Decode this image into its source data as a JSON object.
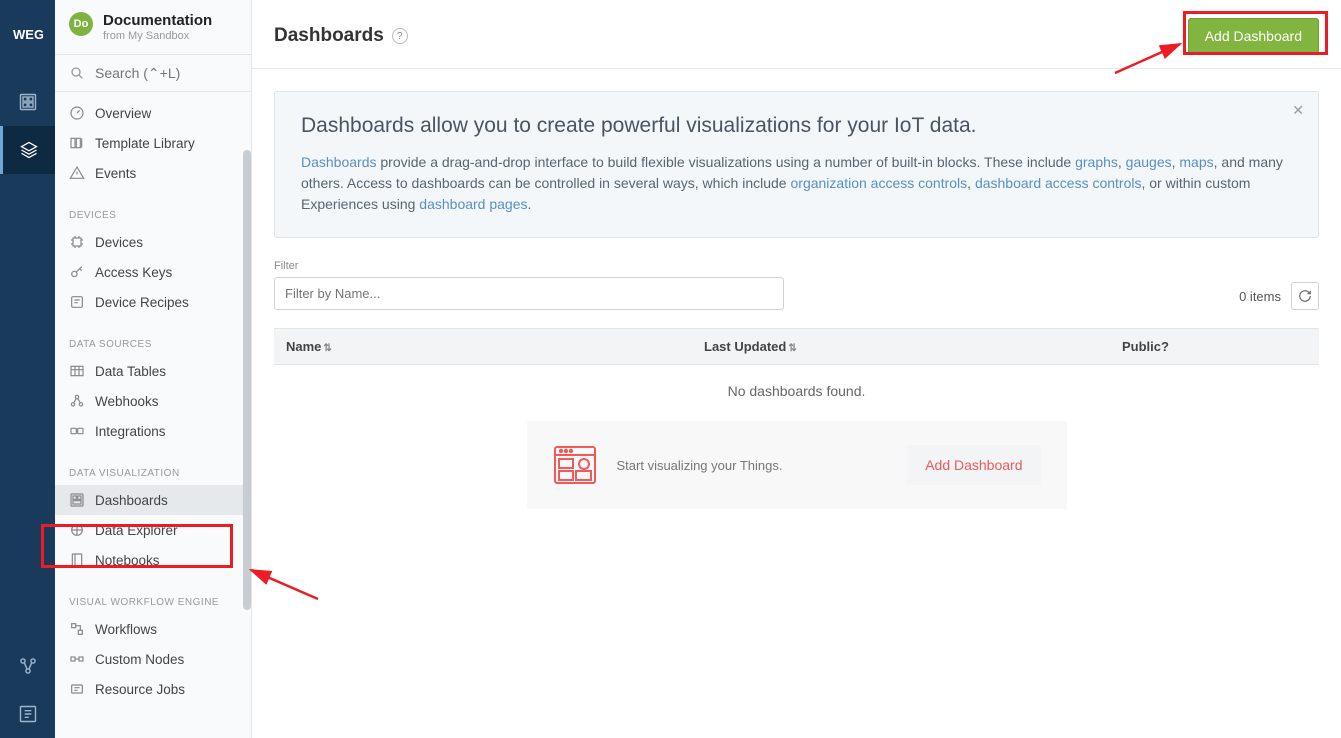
{
  "app": {
    "badge_text": "Do",
    "title": "Documentation",
    "subtitle": "from My Sandbox"
  },
  "search": {
    "placeholder": "Search (⌃+L)"
  },
  "nav": {
    "top": [
      {
        "label": "Overview"
      },
      {
        "label": "Template Library"
      },
      {
        "label": "Events"
      }
    ],
    "sections": [
      {
        "heading": "DEVICES",
        "items": [
          {
            "label": "Devices"
          },
          {
            "label": "Access Keys"
          },
          {
            "label": "Device Recipes"
          }
        ]
      },
      {
        "heading": "DATA SOURCES",
        "items": [
          {
            "label": "Data Tables"
          },
          {
            "label": "Webhooks"
          },
          {
            "label": "Integrations"
          }
        ]
      },
      {
        "heading": "DATA VISUALIZATION",
        "items": [
          {
            "label": "Dashboards",
            "active": true
          },
          {
            "label": "Data Explorer"
          },
          {
            "label": "Notebooks"
          }
        ]
      },
      {
        "heading": "VISUAL WORKFLOW ENGINE",
        "items": [
          {
            "label": "Workflows"
          },
          {
            "label": "Custom Nodes"
          },
          {
            "label": "Resource Jobs"
          }
        ]
      }
    ]
  },
  "page": {
    "title": "Dashboards",
    "add_btn": "Add Dashboard"
  },
  "banner": {
    "heading": "Dashboards allow you to create powerful visualizations for your IoT data.",
    "link_dashboards": "Dashboards",
    "text1": " provide a drag-and-drop interface to build flexible visualizations using a number of built-in blocks. These include ",
    "link_graphs": "graphs",
    "link_gauges": "gauges",
    "link_maps": "maps",
    "text2": ", and many others. Access to dashboards can be controlled in several ways, which include ",
    "link_org": "organization access controls",
    "link_dash_access": "dashboard access controls",
    "text3": ", or within custom Experiences using ",
    "link_pages": "dashboard pages",
    "text4": "."
  },
  "filter": {
    "label": "Filter",
    "placeholder": "Filter by Name...",
    "count": "0 items"
  },
  "table": {
    "col_name": "Name",
    "col_updated": "Last Updated",
    "col_public": "Public?",
    "empty": "No dashboards found."
  },
  "empty_card": {
    "text": "Start visualizing your Things.",
    "btn": "Add Dashboard"
  }
}
